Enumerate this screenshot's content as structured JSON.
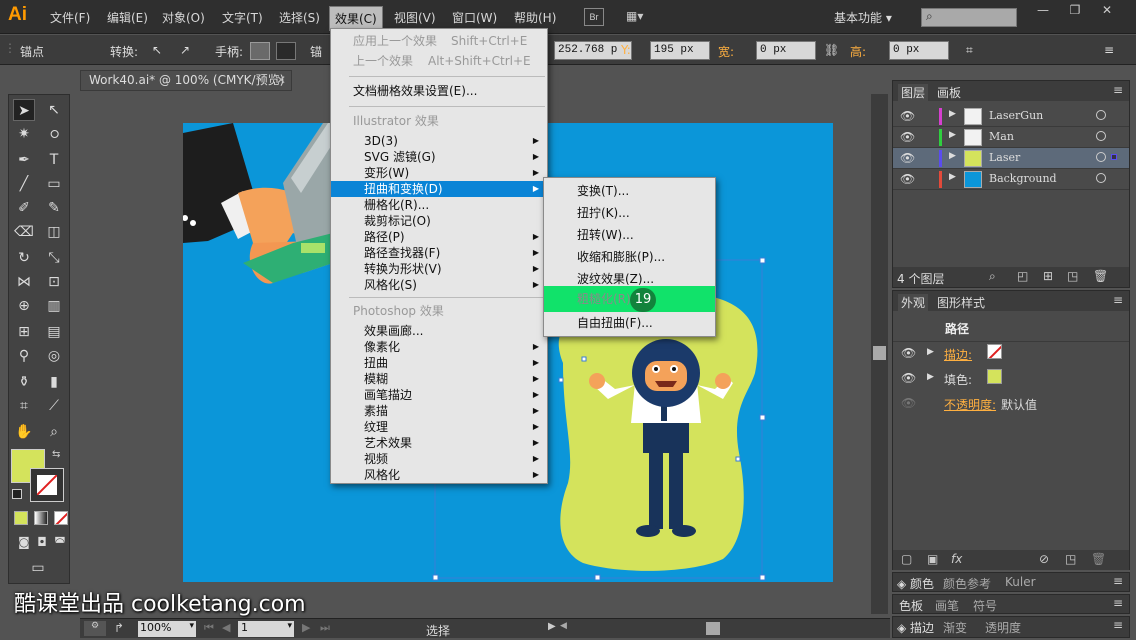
{
  "app": {
    "logo": "Ai",
    "workspace": "基本功能"
  },
  "menubar": [
    "文件(F)",
    "编辑(E)",
    "对象(O)",
    "文字(T)",
    "选择(S)",
    "效果(C)",
    "视图(V)",
    "窗口(W)",
    "帮助(H)"
  ],
  "bridge_label": "Br",
  "control": {
    "anchor": "锚点",
    "convert": "转换:",
    "handles": "手柄:",
    "anchor2": "锚",
    "x_value": "252.768 p",
    "y_label": "Y:",
    "y_value": "195 px",
    "w_label": "宽:",
    "w_value": "0 px",
    "h_label": "高:",
    "h_value": "0 px"
  },
  "document_tab": "Work40.ai* @ 100% (CMYK/预览)",
  "effect_menu": {
    "apply_last": "应用上一个效果",
    "apply_last_sc": "Shift+Ctrl+E",
    "last": "上一个效果",
    "last_sc": "Alt+Shift+Ctrl+E",
    "raster_settings": "文档栅格效果设置(E)...",
    "illustrator_header": "Illustrator 效果",
    "illustrator_items": [
      "3D(3)",
      "SVG 滤镜(G)",
      "变形(W)",
      "扭曲和变换(D)",
      "栅格化(R)...",
      "裁剪标记(O)",
      "路径(P)",
      "路径查找器(F)",
      "转换为形状(V)",
      "风格化(S)"
    ],
    "photoshop_header": "Photoshop 效果",
    "photoshop_items": [
      "效果画廊...",
      "像素化",
      "扭曲",
      "模糊",
      "画笔描边",
      "素描",
      "纹理",
      "艺术效果",
      "视频",
      "风格化"
    ]
  },
  "distort_submenu": [
    "变换(T)...",
    "扭拧(K)...",
    "扭转(W)...",
    "收缩和膨胀(P)...",
    "波纹效果(Z)...",
    "粗糙化(R)...",
    "自由扭曲(F)..."
  ],
  "step_badge": "19",
  "layers_panel": {
    "tabs": [
      "图层",
      "画板"
    ],
    "layers": [
      {
        "name": "LaserGun",
        "color": "#d63fd0"
      },
      {
        "name": "Man",
        "color": "#2fcf3f"
      },
      {
        "name": "Laser",
        "color": "#5a4cf0"
      },
      {
        "name": "Background",
        "color": "#e34a3a"
      }
    ],
    "count": "4 个图层"
  },
  "appearance_panel": {
    "tabs": [
      "外观",
      "图形样式"
    ],
    "title": "路径",
    "stroke": "描边:",
    "fill": "填色:",
    "opacity": "不透明度:",
    "opacity_value": "默认值",
    "fill_color": "#d4e35c"
  },
  "bottom_tabs": [
    [
      "颜色",
      "颜色参考",
      "Kuler"
    ],
    [
      "色板",
      "画笔",
      "符号"
    ],
    [
      "描边",
      "渐变",
      "透明度"
    ]
  ],
  "status": {
    "zoom": "100%",
    "page": "1",
    "tool": "选择"
  },
  "watermark": "酷课堂出品 coolketang.com",
  "colors": {
    "artboard": "#0b96d9",
    "blob": "#d4e35c",
    "highlight": "#11e26a",
    "menu_highlight": "#0a84d6"
  }
}
